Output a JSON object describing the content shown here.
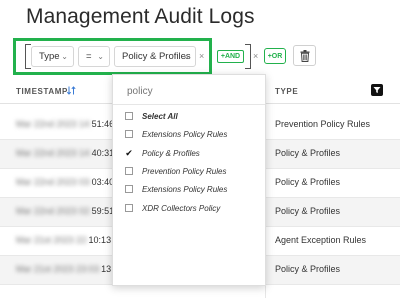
{
  "page": {
    "title": "Management Audit Logs"
  },
  "filter": {
    "field": {
      "label": "Type"
    },
    "operator": {
      "label": "="
    },
    "value": {
      "label": "Policy & Profiles"
    },
    "and_label": "+AND",
    "or_label": "+OR",
    "remove_glyph": "×"
  },
  "table": {
    "columns": {
      "timestamp": "TIMESTAMP",
      "type": "TYPE"
    },
    "rows": [
      {
        "ts_hidden": "Mar 22nd 2023 14:",
        "ts_visible": "51:46",
        "type": "Prevention Policy Rules"
      },
      {
        "ts_hidden": "Mar 22nd 2023 14:",
        "ts_visible": "40:31",
        "type": "Policy & Profiles"
      },
      {
        "ts_hidden": "Mar 22nd 2023 03:",
        "ts_visible": "03:40",
        "type": "Policy & Profiles"
      },
      {
        "ts_hidden": "Mar 22nd 2023 02:",
        "ts_visible": "59:51",
        "type": "Policy & Profiles"
      },
      {
        "ts_hidden": "Mar 21st 2023 22:",
        "ts_visible": "10:13",
        "type": "Agent Exception Rules"
      },
      {
        "ts_hidden": "Mar 21st 2023 23:03:",
        "ts_visible": "13",
        "type": "Policy & Profiles"
      }
    ]
  },
  "dropdown": {
    "search_placeholder": "policy",
    "select_all": "Select All",
    "options": [
      {
        "label": "Extensions Policy Rules",
        "checked": false
      },
      {
        "label": "Policy & Profiles",
        "checked": true
      },
      {
        "label": "Prevention Policy Rules",
        "checked": false
      },
      {
        "label": "Extensions Policy Rules",
        "checked": false
      },
      {
        "label": "XDR Collectors Policy",
        "checked": false
      }
    ],
    "check_glyph": "✔"
  },
  "colors": {
    "accent_green": "#22b14c",
    "row_alt": "#f4f4f4"
  }
}
